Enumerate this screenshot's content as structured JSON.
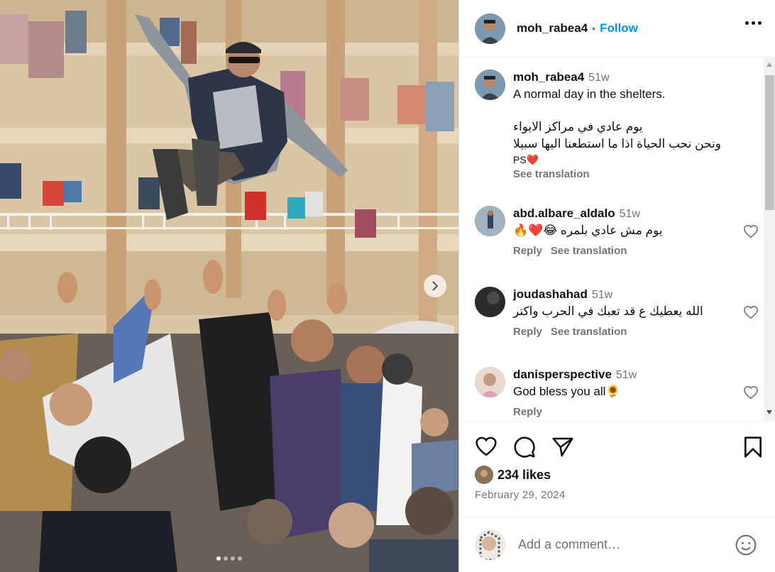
{
  "post": {
    "username": "moh_rabea4",
    "separator": "•",
    "follow_label": "Follow",
    "more_icon": "more-horizontal-icon",
    "photo_index": 1,
    "photo_count": 4
  },
  "caption": {
    "username": "moh_rabea4",
    "time": "51w",
    "line1": "A normal day in the shelters.",
    "line2": "يوم عادي في مراكز الايواء",
    "line3": "ونحن نحب الحياة اذا ما استطعنا اليها سبيلا",
    "line4": "PS❤️",
    "see_translation": "See translation"
  },
  "comments": [
    {
      "username": "abd.albare_aldalo",
      "time": "51w",
      "text": "يوم مش عادي بلمره 😂❤️🔥",
      "reply": "Reply",
      "see_translation": "See translation"
    },
    {
      "username": "joudashahad",
      "time": "51w",
      "text": "الله يعطيك ع قد تعبك في الحرب واكتر",
      "reply": "Reply",
      "see_translation": "See translation"
    },
    {
      "username": "danisperspective",
      "time": "51w",
      "text": "God bless you all🌻",
      "reply": "Reply",
      "see_translation": ""
    }
  ],
  "actions": {
    "like_icon": "heart-icon",
    "comment_icon": "comment-icon",
    "share_icon": "send-icon",
    "save_icon": "bookmark-icon"
  },
  "likes": {
    "count_label": "234 likes"
  },
  "date": "February 29, 2024",
  "add_comment": {
    "placeholder": "Add a comment…",
    "emoji_icon": "emoji-icon"
  },
  "colors": {
    "link": "#0095f6",
    "muted": "#737373",
    "text": "#262626"
  }
}
